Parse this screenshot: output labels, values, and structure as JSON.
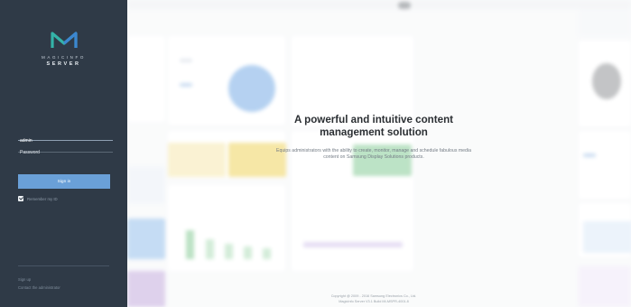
{
  "brand": {
    "line1": "MAGICINFO",
    "line2": "SERVER"
  },
  "login": {
    "id_value": "admin",
    "password_placeholder": "Password",
    "signin_label": "Sign in",
    "remember_label": "Remember my ID"
  },
  "links": {
    "signup": "Sign up",
    "contact": "Contact the administrator"
  },
  "hero": {
    "headline": "A powerful and intuitive content management solution",
    "subtext": "Equips administrators with the ability to create, monitor, manage and schedule fabulous media content on Samsung Display Solutions products."
  },
  "footer": {
    "copyright": "Copyright @ 2009 - 2016 Samsung Electronics Co., Ltd.",
    "version": "MagicInfo Server V3.1 Build MI-MSPR-4001.8"
  },
  "colors": {
    "panel": "#2f3a47",
    "signin_button": "#6aa0d8",
    "logo_teal": "#34b3a8",
    "logo_blue": "#3c86d0"
  }
}
